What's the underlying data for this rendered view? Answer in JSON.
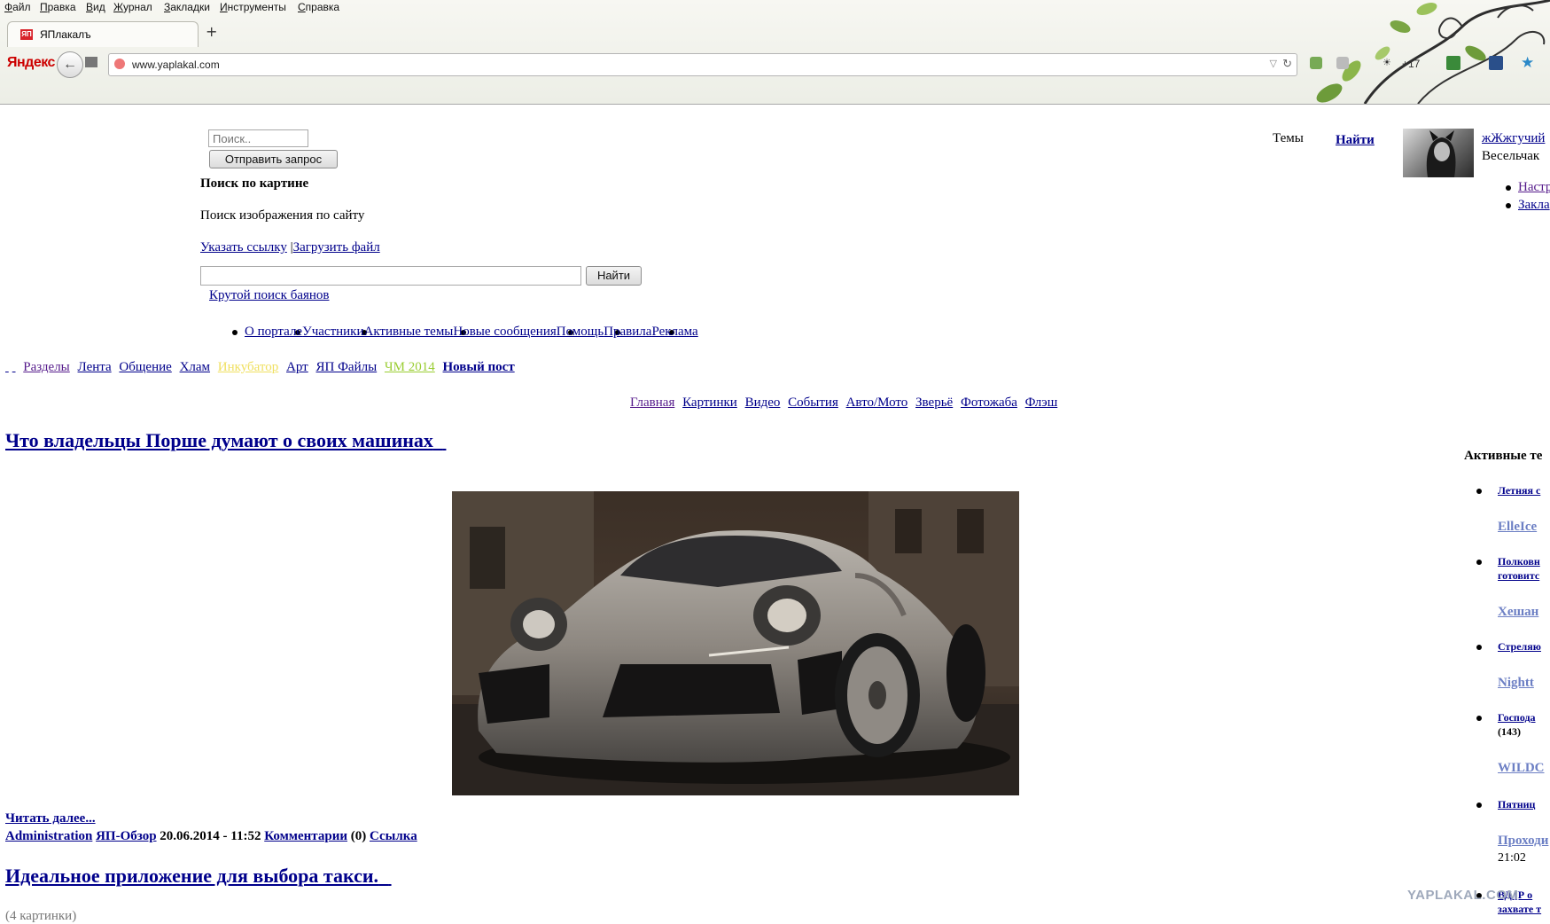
{
  "browser": {
    "menu": [
      "Файл",
      "Правка",
      "Вид",
      "Журнал",
      "Закладки",
      "Инструменты",
      "Справка"
    ],
    "tab_title": "ЯПлакалъ",
    "tab_favicon": "ЯП",
    "new_tab": "+",
    "yandex_logo": "Яндекс",
    "url": "www.yaplakal.com",
    "toolbar_count": "+17"
  },
  "header": {
    "search_placeholder": "Поиск..",
    "search_submit": "Отправить запрос",
    "image_search_title": "Поиск по картине",
    "image_search_desc": "Поиск изображения по сайту",
    "link_url": "Указать ссылку",
    "separator": "|",
    "link_upload": "Загрузить файл",
    "find_button": "Найти",
    "bayan_search": "Крутой поиск баянов",
    "topics_label": "Темы",
    "find_link": "Найти",
    "user_name": "жЖжгучий",
    "user_rank": "Весельчак",
    "user_links": [
      "Настр",
      "Закла"
    ]
  },
  "portal_links": [
    "О портале",
    "Участники",
    "Активные темы",
    "Новые сообщения",
    "Помощь",
    "Правила",
    "Реклама"
  ],
  "main_nav": [
    {
      "label": "Разделы",
      "color": "#551a8b"
    },
    {
      "label": "Лента",
      "color": "#00008b"
    },
    {
      "label": "Общение",
      "color": "#00008b"
    },
    {
      "label": "Хлам",
      "color": "#00008b"
    },
    {
      "label": "Инкубатор",
      "color": "#f0e060"
    },
    {
      "label": "Арт",
      "color": "#00008b"
    },
    {
      "label": "ЯП Файлы",
      "color": "#00008b"
    },
    {
      "label": "ЧМ 2014",
      "color": "#9acd32"
    },
    {
      "label": "Новый пост",
      "color": "#00008b"
    }
  ],
  "category_nav": [
    "Главная",
    "Картинки",
    "Видео",
    "События",
    "Авто/Мото",
    "Зверьё",
    "Фотожаба",
    "Флэш"
  ],
  "article1": {
    "title": "Что владельцы Порше думают о своих машинах",
    "read_more": "Читать далее...",
    "author": "Administration",
    "section": "ЯП-Обзор",
    "date": "20.06.2014 - 11:52",
    "comments_label": "Комментарии",
    "comments_count": "(0)",
    "link_label": "Ссылка"
  },
  "article2": {
    "title": "Идеальное приложение для выбора такси.",
    "subtitle": "(4 картинки)"
  },
  "sidebar": {
    "title": "Активные те",
    "items": [
      {
        "title": "Летняя с",
        "user": "ElleIce"
      },
      {
        "title": "Полковн",
        "title2": "готовитс",
        "user": "Хешан"
      },
      {
        "title": "Стреляю",
        "user": "Nightt"
      },
      {
        "title": "Господа",
        "count": "(143)",
        "user": "WILDC"
      },
      {
        "title": "Пятниц",
        "user": "Проходи",
        "time": "21:02"
      },
      {
        "title": "ВД [Р о",
        "title2": "захвате т"
      }
    ]
  },
  "watermark": "YAPLAKAL.COM"
}
